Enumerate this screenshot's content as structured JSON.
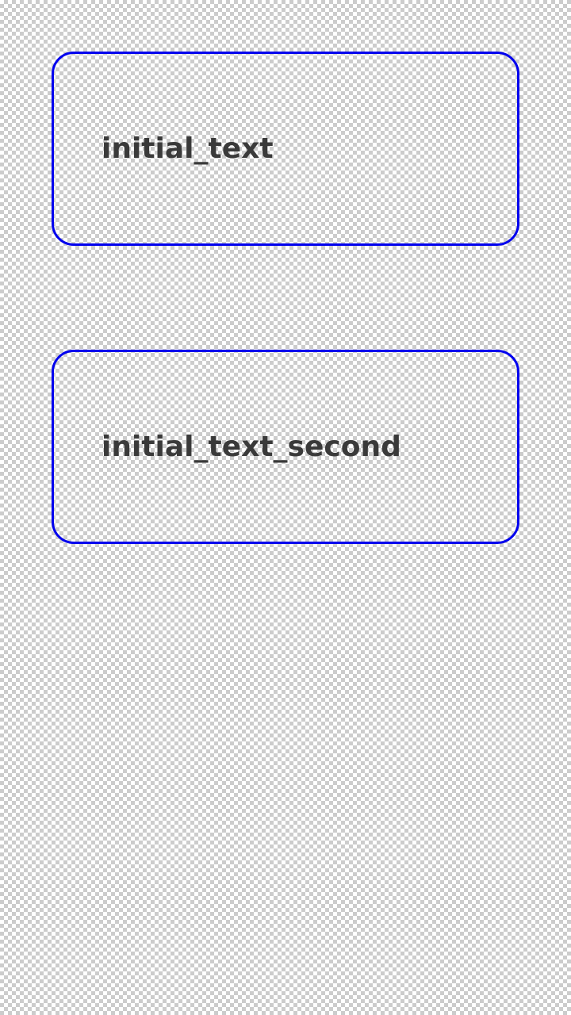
{
  "fields": [
    {
      "text": "initial_text"
    },
    {
      "text": "initial_text_second"
    }
  ],
  "colors": {
    "border": "#0000ee",
    "text": "#3a3a3a"
  }
}
